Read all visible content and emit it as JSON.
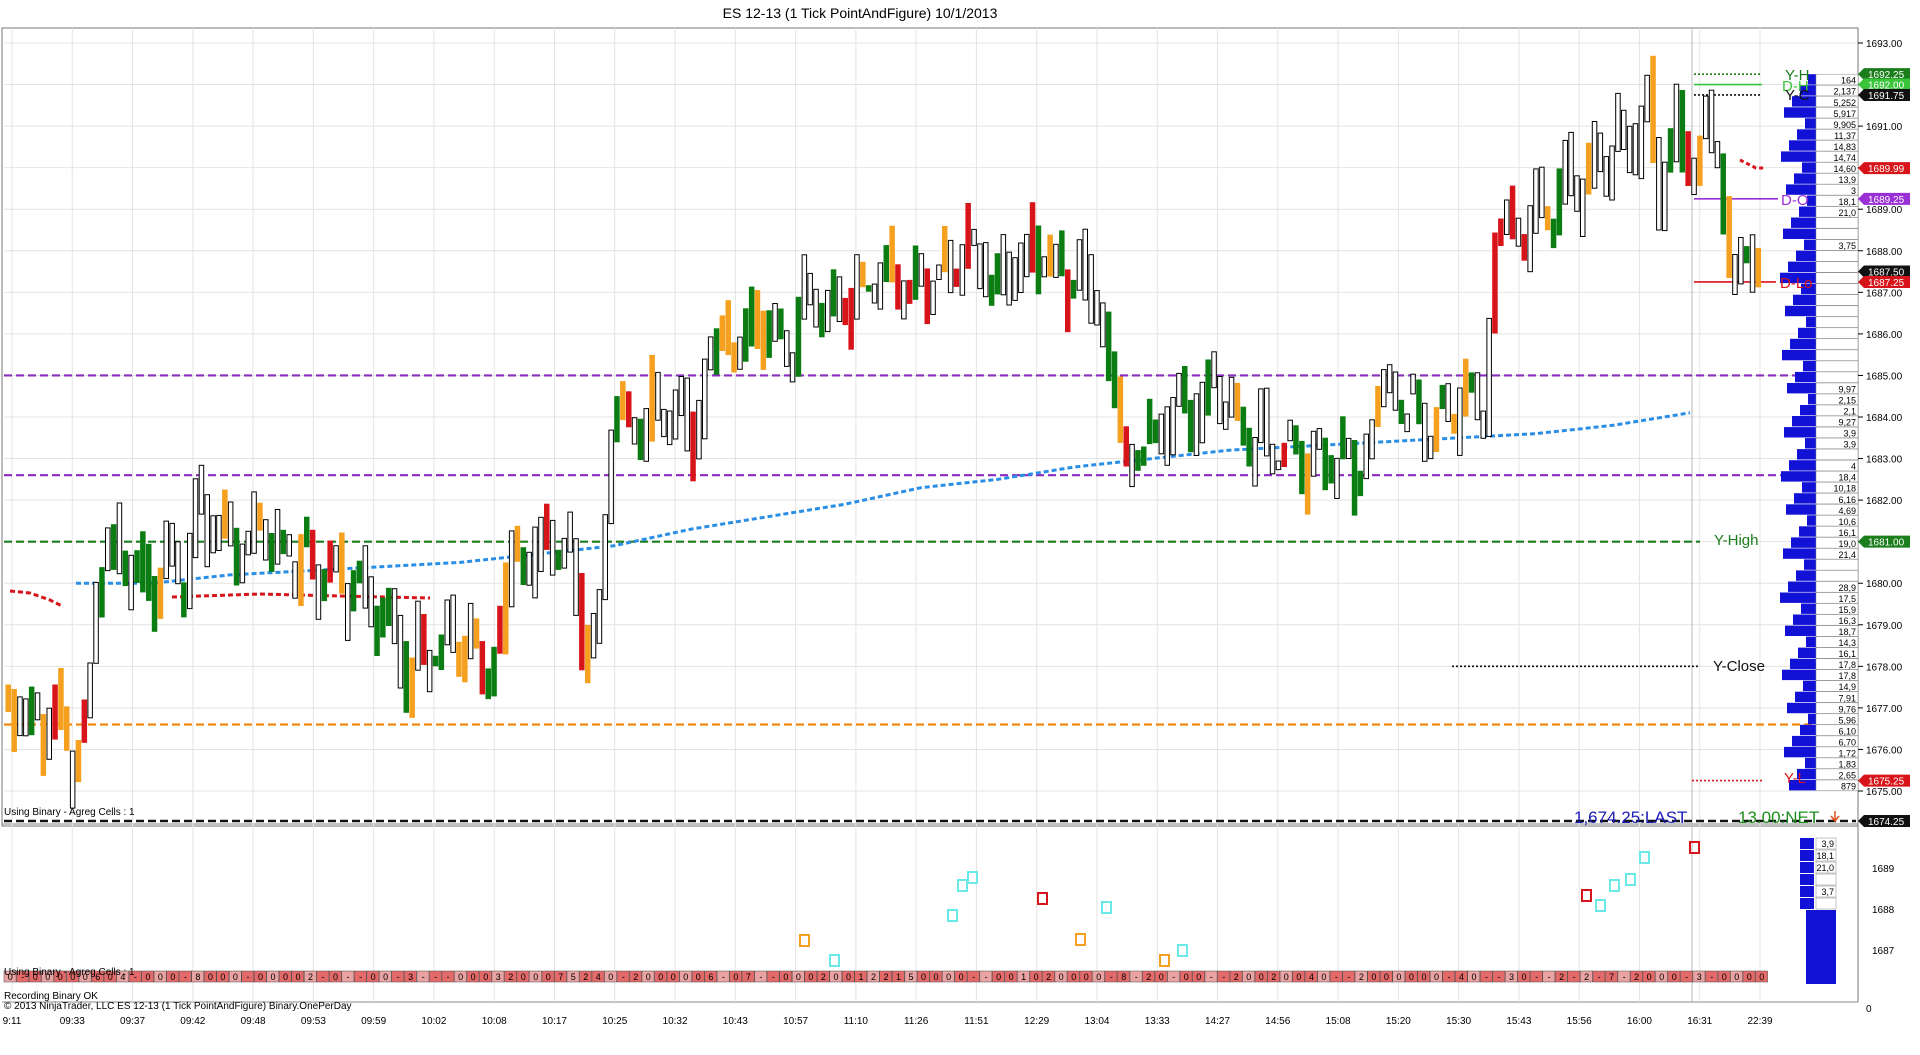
{
  "window": {
    "title": "ES 12-13 (1 Tick PointAndFigure)  10/1/2013"
  },
  "colors": {
    "background": "#ffffff",
    "grid": "#e4e4e4",
    "up_bar": "#0b7d12",
    "down_bar": "#d8141b",
    "orange_bar": "#f5a01e",
    "hollow_bar": "#000000",
    "vwap": "#2a8ee6",
    "purple_level": "#8a2bc2",
    "green_level": "#1b7d1b",
    "orange_level": "#f08b0c",
    "dom_blue": "#1212d6",
    "last_text": "#1c1cb6",
    "net_text": "#1f8f1f"
  },
  "price_axis": {
    "ticks": [
      "1693.00",
      "1692.00",
      "1691.00",
      "1690.00",
      "1689.00",
      "1688.00",
      "1687.00",
      "1686.00",
      "1685.00",
      "1684.00",
      "1683.00",
      "1682.00",
      "1681.00",
      "1680.00",
      "1679.00",
      "1678.00",
      "1677.00",
      "1676.00",
      "1675.00"
    ],
    "tags": [
      {
        "text": "1692.25",
        "color": "#1b7d1b"
      },
      {
        "text": "1692.00",
        "color": "#39c439"
      },
      {
        "text": "1691.75",
        "color": "#111111"
      },
      {
        "text": "1689.99",
        "color": "#d8141b"
      },
      {
        "text": "1689.25",
        "color": "#9a2fd6"
      },
      {
        "text": "1687.50",
        "color": "#111111"
      },
      {
        "text": "1687.25",
        "color": "#d8141b"
      },
      {
        "text": "1681.00",
        "color": "#1b7d1b"
      },
      {
        "text": "1675.25",
        "color": "#d8141b"
      },
      {
        "text": "1674.25",
        "color": "#111111"
      }
    ]
  },
  "time_axis": {
    "labels": [
      "9:11",
      "09:33",
      "09:37",
      "09:42",
      "09:48",
      "09:53",
      "09:59",
      "10:02",
      "10:08",
      "10:17",
      "10:25",
      "10:32",
      "10:43",
      "10:57",
      "11:10",
      "11:26",
      "11:51",
      "12:29",
      "13:04",
      "13:33",
      "14:27",
      "14:56",
      "15:08",
      "15:20",
      "15:30",
      "15:43",
      "15:56",
      "16:00",
      "16:31",
      "22:39"
    ]
  },
  "levels": {
    "y_high": "Y-High",
    "y_close": "Y-Close",
    "y_low_short": "Y-L",
    "y_high_short": "Y-H",
    "d_high_short": "D-H",
    "y_close_short": "Y-C",
    "d_open_short": "D-O",
    "d_low_short": "D-Lo"
  },
  "status": {
    "main_label": "Using Binary - Agreg Cells : 1",
    "sub_label": "Using Binary - Agreg Cells : 1",
    "last": "1,674.25:LAST",
    "net": "13.00:NET",
    "recording": "Recording Binary OK",
    "study_label": "© 2013 NinjaTrader, LLC  ES 12-13 (1 Tick PointAndFigure) Binary.OnePerDay"
  },
  "dom_volumes": [
    "164",
    "2,137",
    "5,252",
    "5,917",
    "9,905",
    "11,37",
    "14,83",
    "14,74",
    "14,60",
    "13,9",
    "3",
    "18,1",
    "21,0",
    "",
    "",
    "3,75",
    "",
    "",
    "",
    "",
    "",
    "",
    "",
    "",
    "",
    "",
    "",
    "",
    "9,97",
    "2,15",
    "2,1",
    "9,27",
    "3,9",
    "3,9",
    "",
    "4",
    "18,4",
    "10,18",
    "6,16",
    "4,69",
    "10,6",
    "16,1",
    "19,0",
    "21,4",
    "",
    "",
    "28,9",
    "17,5",
    "15,9",
    "16,3",
    "18,7",
    "14,3",
    "16,1",
    "17,8",
    "17,8",
    "14,9",
    "7,91",
    "9,76",
    "5,96",
    "6,10",
    "6,70",
    "1,72",
    "1,83",
    "2,65",
    "879"
  ],
  "sub_dom_volumes": [
    "3,9",
    "18,1",
    "21,0",
    "",
    "3,7",
    ""
  ],
  "sub_axis": {
    "ticks": [
      "1689",
      "1688",
      "1687"
    ],
    "zero": "0"
  },
  "sub_cell_row": "0-00000604-000-8000-00002-0--00-3---0003200075240-2000006-07--000200122150000--001020000-8-20-00--20020040--2000000-40--30--2-2-7-2000-3-0000",
  "chart_data": {
    "type": "point-and-figure",
    "instrument": "ES 12-13",
    "title": "ES 12-13 (1 Tick PointAndFigure)  10/1/2013",
    "ylim": [
      1674.25,
      1693.25
    ],
    "tick_size": 0.25,
    "levels": [
      {
        "name": "Y-High",
        "value": 1681.0,
        "style": "dashed",
        "color": "#1b7d1b"
      },
      {
        "name": "Y-Close",
        "value": 1678.0,
        "style": "dotted",
        "color": "#111111"
      },
      {
        "name": "Y-L",
        "value": 1675.25,
        "style": "dotted",
        "color": "#d8141b"
      },
      {
        "name": "purple-upper",
        "value": 1685.0,
        "style": "dashed",
        "color": "#8a2bc2"
      },
      {
        "name": "purple-lower",
        "value": 1682.6,
        "style": "dashed",
        "color": "#8a2bc2"
      },
      {
        "name": "orange",
        "value": 1676.6,
        "style": "dashed",
        "color": "#f08b0c"
      },
      {
        "name": "Y-H",
        "value": 1692.25,
        "style": "dotted",
        "color": "#1b7d1b"
      },
      {
        "name": "D-H",
        "value": 1692.0,
        "style": "solid",
        "color": "#39c439"
      },
      {
        "name": "Y-C",
        "value": 1691.75,
        "style": "dotted",
        "color": "#111111"
      },
      {
        "name": "D-O",
        "value": 1689.25,
        "style": "solid",
        "color": "#9a2fd6"
      },
      {
        "name": "D-Lo",
        "value": 1687.25,
        "style": "solid",
        "color": "#d8141b"
      }
    ],
    "price_path": [
      1677.5,
      1676.5,
      1677.3,
      1676.0,
      1677.6,
      1675.2,
      1677.0,
      1680.5,
      1681.2,
      1679.9,
      1680.8,
      1679.4,
      1681.3,
      1679.6,
      1682.5,
      1680.8,
      1681.7,
      1680.2,
      1681.9,
      1680.6,
      1681.4,
      1680.1,
      1681.2,
      1679.7,
      1680.8,
      1679.3,
      1680.5,
      1678.7,
      1679.9,
      1677.2,
      1679.0,
      1677.8,
      1679.3,
      1677.9,
      1679.0,
      1677.5,
      1678.8,
      1681.0,
      1680.0,
      1681.8,
      1680.6,
      1681.2,
      1678.2,
      1679.8,
      1683.5,
      1684.5,
      1683.3,
      1685.0,
      1683.6,
      1684.6,
      1683.0,
      1685.2,
      1686.3,
      1685.4,
      1686.8,
      1685.6,
      1686.4,
      1685.2,
      1687.5,
      1686.2,
      1687.2,
      1686.0,
      1687.5,
      1686.7,
      1688.0,
      1686.8,
      1687.8,
      1686.6,
      1688.2,
      1687.0,
      1688.5,
      1687.2,
      1687.8,
      1686.8,
      1688.6,
      1687.3,
      1688.2,
      1686.7,
      1688.0,
      1686.5,
      1685.5,
      1683.5,
      1682.8,
      1684.0,
      1683.2,
      1684.8,
      1683.5,
      1685.2,
      1683.8,
      1684.6,
      1683.0,
      1684.2,
      1682.6,
      1683.8,
      1682.2,
      1683.6,
      1682.7,
      1683.4,
      1682.3,
      1683.8,
      1685.0,
      1683.9,
      1684.8,
      1683.3,
      1684.7,
      1683.6,
      1685.1,
      1683.9,
      1688.3,
      1689.0,
      1688.0,
      1689.6,
      1688.4,
      1690.3,
      1689.0,
      1690.8,
      1689.5,
      1691.5,
      1690.2,
      1692.2,
      1688.8,
      1691.6,
      1689.4,
      1691.2,
      1690.0,
      1687.3,
      1688.0,
      1687.1
    ],
    "vwap": [
      1680.0,
      1680.0,
      1680.2,
      1680.3,
      1680.4,
      1680.5,
      1680.7,
      1680.9,
      1681.3,
      1681.6,
      1681.9,
      1682.3,
      1682.5,
      1682.8,
      1683.0,
      1683.2,
      1683.3,
      1683.4,
      1683.5,
      1683.6,
      1683.8,
      1684.1
    ],
    "time_labels": [
      "9:11",
      "09:33",
      "09:37",
      "09:42",
      "09:48",
      "09:53",
      "09:59",
      "10:02",
      "10:08",
      "10:17",
      "10:25",
      "10:32",
      "10:43",
      "10:57",
      "11:10",
      "11:26",
      "11:51",
      "12:29",
      "13:04",
      "13:33",
      "14:27",
      "14:56",
      "15:08",
      "15:20",
      "15:30",
      "15:43",
      "15:56",
      "16:00",
      "16:31",
      "22:39"
    ],
    "last": 1674.25,
    "net": 13.0
  }
}
